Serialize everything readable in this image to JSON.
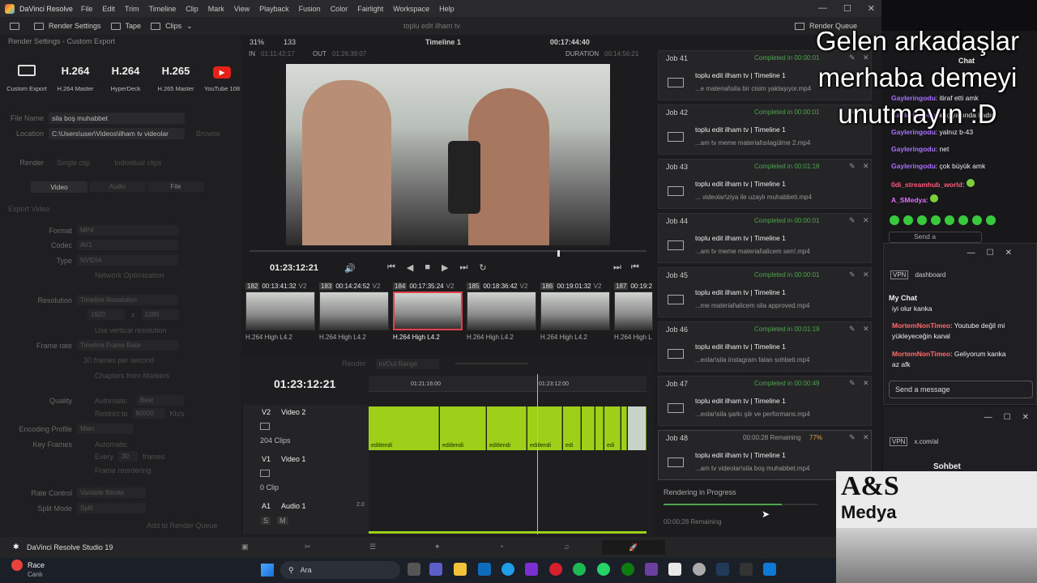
{
  "menubar": {
    "app": "DaVinci Resolve",
    "items": [
      "File",
      "Edit",
      "Trim",
      "Timeline",
      "Clip",
      "Mark",
      "View",
      "Playback",
      "Fusion",
      "Color",
      "Fairlight",
      "Workspace",
      "Help"
    ]
  },
  "toolbar": {
    "render_settings": "Render Settings",
    "tape": "Tape",
    "clips": "Clips",
    "project": "toplu edit ilham tv",
    "render_queue": "Render Queue"
  },
  "render_settings": {
    "title": "Render Settings - Custom Export",
    "presets": [
      {
        "big": "",
        "label": "Custom Export"
      },
      {
        "big": "H.264",
        "label": "H.264 Master"
      },
      {
        "big": "H.264",
        "label": "HyperDeck"
      },
      {
        "big": "H.265",
        "label": "H.265 Master"
      },
      {
        "big": "",
        "label": "YouTube 108"
      }
    ],
    "file_name_label": "File Name",
    "file_name": "sila boş muhabbet",
    "location_label": "Location",
    "location": "C:\\Users\\user\\Videos\\ilham tv videolar",
    "browse": "Browse",
    "render_label": "Render",
    "single_clip": "Single clip",
    "individual_clips": "Individual clips",
    "tabs": [
      "Video",
      "Audio",
      "File"
    ],
    "export_video": "Export Video",
    "format_label": "Format",
    "format": "MP4",
    "codec_label": "Codec",
    "codec": "AV1",
    "type_label": "Type",
    "type": "NVIDIA",
    "network_opt": "Network Optimization",
    "resolution_label": "Resolution",
    "resolution": "Timeline Resolution",
    "res_w": "1920",
    "res_x": "x",
    "res_h": "1080",
    "vertical": "Use vertical resolution",
    "frame_rate_label": "Frame rate",
    "frame_rate": "Timeline Frame Rate",
    "fps": "30 frames per second",
    "chapters": "Chapters from Markers",
    "quality_label": "Quality",
    "automatic": "Automatic",
    "best": "Best",
    "restrict": "Restrict to",
    "restrict_val": "80000",
    "kbs": "Kb/s",
    "enc_profile_label": "Encoding Profile",
    "enc_profile": "Main",
    "keyframes_label": "Key Frames",
    "kf_auto": "Automatic",
    "every": "Every",
    "every_val": "30",
    "frames": "frames",
    "frame_reorder": "Frame reordering",
    "rate_control_label": "Rate Control",
    "rate_control": "Variable Bitrate",
    "split_mode_label": "Split Mode",
    "split_mode": "Split",
    "add_queue": "Add to Render Queue"
  },
  "viewer": {
    "zoom": "31%",
    "frame": "133",
    "timeline": "Timeline 1",
    "timecode": "00:17:44:40",
    "in_label": "IN",
    "in_tc": "01:11:42:17",
    "out_label": "OUT",
    "out_tc": "01:26:39:07",
    "duration_label": "DURATION",
    "duration": "00:14:56:21",
    "current_tc": "01:23:12:21"
  },
  "clips": [
    {
      "num": "182",
      "tc": "00:13:41:32",
      "v": "V2",
      "cap": "H.264 High L4.2"
    },
    {
      "num": "183",
      "tc": "00:14:24:52",
      "v": "V2",
      "cap": "H.264 High L4.2"
    },
    {
      "num": "184",
      "tc": "00:17:35:24",
      "v": "V2",
      "cap": "H.264 High L4.2"
    },
    {
      "num": "185",
      "tc": "00:18:36:42",
      "v": "V2",
      "cap": "H.264 High L4.2"
    },
    {
      "num": "186",
      "tc": "00:19:01:32",
      "v": "V2",
      "cap": "H.264 High L4.2"
    },
    {
      "num": "187",
      "tc": "00:19:2",
      "v": "",
      "cap": "H.264 High L"
    }
  ],
  "timeline": {
    "render_label": "Render",
    "render_range": "In/Out Range",
    "tc": "01:23:12:21",
    "ruler1": "01:21:16:00",
    "ruler2": "01:23:12:00",
    "v2_label": "V2",
    "v2_name": "Video 2",
    "v2_clips": "204 Clips",
    "v1_label": "V1",
    "v1_name": "Video 1",
    "v1_clips": "0 Clip",
    "a1_label": "A1",
    "a1_name": "Audio 1",
    "a1_level": "2.0",
    "clip_name": "editlendi",
    "clip_short": "edi"
  },
  "queue": {
    "title": "Render Queue",
    "jobs": [
      {
        "job": "Job 41",
        "status": "Completed in 00:00:01",
        "title": "toplu edit ilham tv | Timeline 1",
        "file": "...e material\\sila bir cisim yaklaşıyor.mp4"
      },
      {
        "job": "Job 42",
        "status": "Completed in 00:00:01",
        "title": "toplu edit ilham tv | Timeline 1",
        "file": "...am tv meme material\\sılagülme 2.mp4"
      },
      {
        "job": "Job 43",
        "status": "Completed in 00:01:18",
        "title": "toplu edit ilham tv | Timeline 1",
        "file": "... videolar\\ziya ile uzaylı muhabbeti.mp4"
      },
      {
        "job": "Job 44",
        "status": "Completed in 00:00:01",
        "title": "toplu edit ilham tv | Timeline 1",
        "file": "...am tv meme material\\alicem sen!.mp4"
      },
      {
        "job": "Job 45",
        "status": "Completed in 00:00:01",
        "title": "toplu edit ilham tv | Timeline 1",
        "file": "...me material\\alicem sila approved.mp4"
      },
      {
        "job": "Job 46",
        "status": "Completed in 00:01:19",
        "title": "toplu edit ilham tv | Timeline 1",
        "file": "...eolar\\sila instagram falan sohbeti.mp4"
      },
      {
        "job": "Job 47",
        "status": "Completed in 00:00:49",
        "title": "toplu edit ilham tv | Timeline 1",
        "file": "...eolar\\sila şarkı şiir ve performans.mp4"
      },
      {
        "job": "Job 48",
        "status": "00:00:28 Remaining",
        "pct": "77%",
        "title": "toplu edit ilham tv | Timeline 1",
        "file": "...am tv videolar\\sila boş muhabbet.mp4"
      }
    ],
    "in_progress": "Rendering in Progress",
    "remaining": "00:00:28 Remaining",
    "progress": 0.77
  },
  "bottom": {
    "app": "DaVinci Resolve Studio 19",
    "race": "Race",
    "race_sub": "Canlı"
  },
  "taskbar": {
    "search": "Ara"
  },
  "overlay": [
    "Gelen arkadaşlar",
    "merhaba demeyi",
    "unutmayın :D"
  ],
  "chat": {
    "title": "Chat",
    "lines": [
      {
        "user": "Gayleringodu",
        "msg": "itiraf etti amk"
      },
      {
        "user": "Gayleringodu",
        "msg": "kaç yaşında kadın"
      },
      {
        "user": "Gayleringodu",
        "msg": "yalnız b-43"
      },
      {
        "user": "Gayleringodu",
        "msg": "net"
      },
      {
        "user": "Gayleringodu",
        "msg": "çok büyük amk"
      },
      {
        "user": "0di_streamhub_world",
        "msg": ""
      },
      {
        "user": "A_SMedya",
        "msg": ""
      }
    ],
    "send": "Send a"
  },
  "chat2": {
    "url": "dashboard",
    "title": "My Chat",
    "lines": [
      {
        "user": "",
        "msg": "iyi olur kanka"
      },
      {
        "user": "MortemNonTimeo",
        "msg": "Youtube değil mi yükleyeceğin kanal"
      },
      {
        "user": "MortemNonTimeo",
        "msg": "Geliyorum kanka az afk"
      }
    ],
    "send": "Send a message"
  },
  "chat3": {
    "url": "x.com/al",
    "title": "Sohbet"
  },
  "logo": {
    "text": "A&S",
    "sub": "Medya"
  }
}
